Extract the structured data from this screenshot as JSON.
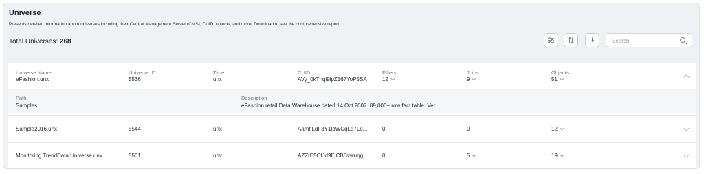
{
  "header": {
    "title": "Universe",
    "subtitle": "Presents detailed information about universes including their Central Management Server (CMS), CUID, objects, and more. Download to see the comprehensive report.",
    "total_label": "Total Universes:",
    "total_value": "268"
  },
  "toolbar": {
    "filter_icon": "sliders-icon",
    "sort_icon": "sort-arrows-icon",
    "download_icon": "download-icon",
    "search_placeholder": "Search",
    "search_icon": "search-icon"
  },
  "columns": {
    "name": "Universe Name",
    "id": "Universe ID",
    "type": "Type",
    "cuid": "CUID",
    "filters": "Filters",
    "joins": "Joins",
    "objects": "Objects"
  },
  "detail_columns": {
    "path": "Path",
    "description": "Description"
  },
  "rows": [
    {
      "name": "eFashion.unx",
      "id": "5536",
      "type": "unx",
      "cuid": "AVy_0kTnql9lpZ167YoP5SA",
      "filters": "12",
      "joins": "9",
      "objects": "51",
      "path": "Samples",
      "description": "eFashion retail Data Warehouse dated 14 Oct 2007. 89,000+ row fact table. Ver..."
    },
    {
      "name": "Sample2016.unx",
      "id": "5544",
      "type": "unx",
      "cuid": "AamfjLdF3Y1loWCqLq7Lo...",
      "filters": "0",
      "joins": "0",
      "objects": "12"
    },
    {
      "name": "Monitoring TrendData Universe.unv",
      "id": "5561",
      "type": "unv",
      "cuid": "AZZrE5CfJd9EjCBBvwuqg...",
      "filters": "0",
      "joins": "5",
      "objects": "19"
    }
  ]
}
